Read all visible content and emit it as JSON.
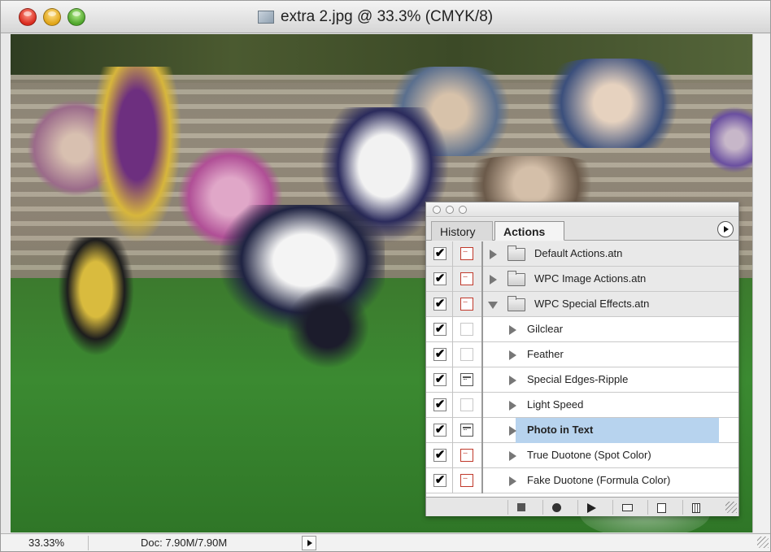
{
  "window": {
    "title": "extra 2.jpg @ 33.3% (CMYK/8)",
    "controls": [
      "close",
      "minimize",
      "zoom"
    ]
  },
  "canvas": {
    "image_description_icon": "document-image-icon"
  },
  "statusbar": {
    "zoom": "33.33%",
    "doc_info": "Doc: 7.90M/7.90M"
  },
  "palette": {
    "tabs": [
      {
        "label": "History",
        "active": false
      },
      {
        "label": "Actions",
        "active": true
      }
    ],
    "rows": [
      {
        "label": "Default Actions.atn",
        "type": "set",
        "checked": true,
        "dialog": "red",
        "expanded": false
      },
      {
        "label": "WPC Image Actions.atn",
        "type": "set",
        "checked": true,
        "dialog": "red",
        "expanded": false
      },
      {
        "label": "WPC Special Effects.atn",
        "type": "set",
        "checked": true,
        "dialog": "red",
        "expanded": true
      },
      {
        "label": "Gilclear",
        "type": "action",
        "checked": true,
        "dialog": "empty"
      },
      {
        "label": "Feather",
        "type": "action",
        "checked": true,
        "dialog": "empty"
      },
      {
        "label": "Special Edges-Ripple",
        "type": "action",
        "checked": true,
        "dialog": "dark"
      },
      {
        "label": "Light Speed",
        "type": "action",
        "checked": true,
        "dialog": "empty"
      },
      {
        "label": "Photo in Text",
        "type": "action",
        "checked": true,
        "dialog": "dark",
        "selected": true
      },
      {
        "label": "True Duotone (Spot Color)",
        "type": "action",
        "checked": true,
        "dialog": "red"
      },
      {
        "label": "Fake Duotone (Formula Color)",
        "type": "action",
        "checked": true,
        "dialog": "red"
      }
    ],
    "check_glyph": "✔",
    "footer_buttons": [
      "stop-icon",
      "record-icon",
      "play-icon",
      "new-set-icon",
      "new-action-icon",
      "trash-icon"
    ]
  },
  "colors": {
    "selection": "#b7d3ee",
    "dialog_red": "#c0392b"
  }
}
